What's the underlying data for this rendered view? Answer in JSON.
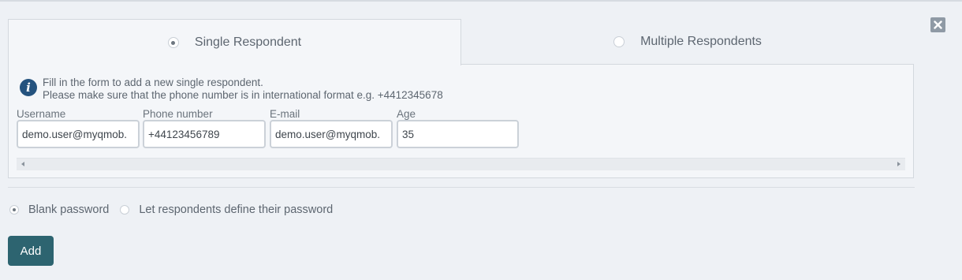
{
  "tabs": [
    {
      "label": "Single Respondent",
      "selected": true
    },
    {
      "label": "Multiple Respondents",
      "selected": false
    }
  ],
  "info": {
    "line1": "Fill in the form to add a new single respondent.",
    "line2": "Please make sure that the phone number is in international format e.g. +4412345678"
  },
  "form": {
    "username_label": "Username",
    "username_value": "demo.user@myqmob.",
    "phone_label": "Phone number",
    "phone_value": "+44123456789",
    "email_label": "E-mail",
    "email_value": "demo.user@myqmob.",
    "age_label": "Age",
    "age_value": "35"
  },
  "password_options": [
    {
      "label": "Blank password",
      "selected": true
    },
    {
      "label": "Let respondents define their password",
      "selected": false
    }
  ],
  "add_button_label": "Add",
  "icons": {
    "close": "close-icon",
    "info": "info-icon"
  },
  "colors": {
    "accent_button": "#2d6470",
    "info_icon": "#24527e",
    "close_icon": "#8f9aa5"
  }
}
